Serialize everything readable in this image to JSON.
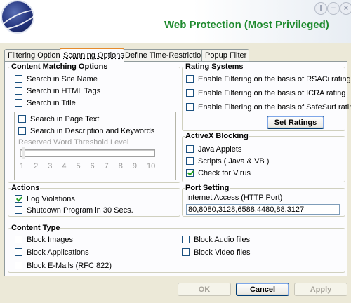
{
  "window": {
    "title": "Web Protection (Most Privileged)",
    "controls": [
      "i",
      "−",
      "×"
    ]
  },
  "tabs": [
    {
      "label": "Filtering Options",
      "active": false
    },
    {
      "label": "Scanning Options",
      "active": true
    },
    {
      "label": "Define Time-Restriction",
      "active": false
    },
    {
      "label": "Popup Filter",
      "active": false
    }
  ],
  "content_matching": {
    "title": "Content Matching Options",
    "options": [
      {
        "label": "Search in Site Name",
        "checked": false
      },
      {
        "label": "Search in HTML Tags",
        "checked": false
      },
      {
        "label": "Search in Title",
        "checked": false
      }
    ],
    "sub_options": [
      {
        "label": "Search in Page Text",
        "checked": false
      },
      {
        "label": "Search in Description and Keywords",
        "checked": false
      }
    ],
    "threshold_label": "Reserved Word Threshold Level",
    "threshold_value": 1,
    "ticks": [
      "1",
      "2",
      "3",
      "4",
      "5",
      "6",
      "7",
      "8",
      "9",
      "10"
    ]
  },
  "rating_systems": {
    "title": "Rating Systems",
    "options": [
      {
        "label": "Enable Filtering on the basis of RSACi rating",
        "checked": false
      },
      {
        "label": "Enable Filtering on the basis of ICRA rating",
        "checked": false
      },
      {
        "label": "Enable Filtering on the basis of SafeSurf rating",
        "checked": false
      }
    ],
    "button_pre": "",
    "button_u": "S",
    "button_post": "et Ratings"
  },
  "activex": {
    "title": "ActiveX Blocking",
    "options": [
      {
        "label": "Java Applets",
        "checked": false
      },
      {
        "label": "Scripts ( Java & VB )",
        "checked": false
      },
      {
        "label": "Check for Virus",
        "checked": true
      }
    ]
  },
  "actions": {
    "title": "Actions",
    "options": [
      {
        "label": "Log Violations",
        "checked": true
      },
      {
        "label": "Shutdown Program in 30 Secs.",
        "checked": false
      }
    ]
  },
  "port_setting": {
    "title": "Port Setting",
    "label": "Internet Access (HTTP Port)",
    "value": "80,8080,3128,6588,4480,88,3127"
  },
  "content_type": {
    "title": "Content Type",
    "left": [
      {
        "label": "Block Images",
        "checked": false
      },
      {
        "label": "Block Applications",
        "checked": false
      },
      {
        "label": "Block E-Mails (RFC 822)",
        "checked": false
      }
    ],
    "right": [
      {
        "label": "Block Audio files",
        "checked": false
      },
      {
        "label": "Block Video files",
        "checked": false
      }
    ]
  },
  "buttons": {
    "ok": "OK",
    "cancel": "Cancel",
    "apply": "Apply"
  }
}
